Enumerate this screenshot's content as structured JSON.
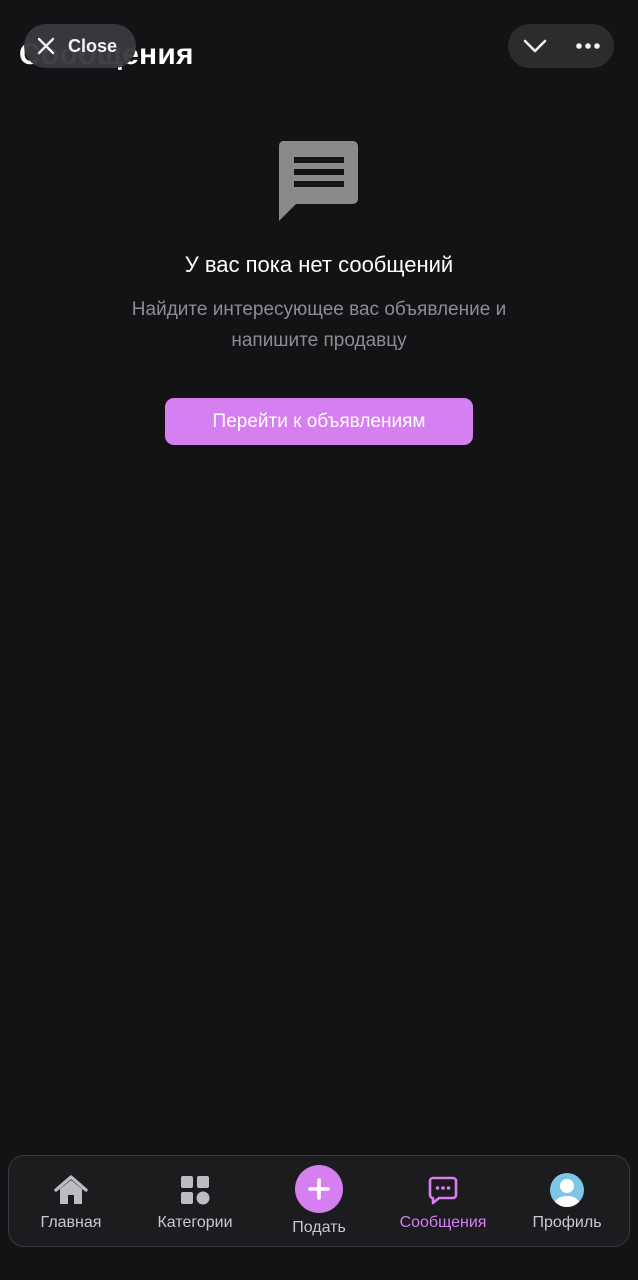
{
  "header": {
    "title": "Сообщения",
    "close_label": "Close"
  },
  "empty_state": {
    "heading": "У вас пока нет сообщений",
    "subtext_line1": "Найдите интересующее вас объявление и",
    "subtext_line2": "напишите продавцу",
    "button_label": "Перейти к объявлениям",
    "icon": "chat-bubble-icon"
  },
  "bottom_nav": {
    "items": [
      {
        "label": "Главная",
        "icon": "home-icon",
        "active": false
      },
      {
        "label": "Категории",
        "icon": "categories-icon",
        "active": false
      },
      {
        "label": "Подать",
        "icon": "plus-icon",
        "active": false
      },
      {
        "label": "Сообщения",
        "icon": "messages-icon",
        "active": true
      },
      {
        "label": "Профиль",
        "icon": "avatar-icon",
        "active": false
      }
    ]
  },
  "colors": {
    "background": "#131214",
    "accent": "#d57ff0",
    "muted_text": "#8e8c91",
    "nav_background": "#1c1b1e"
  }
}
